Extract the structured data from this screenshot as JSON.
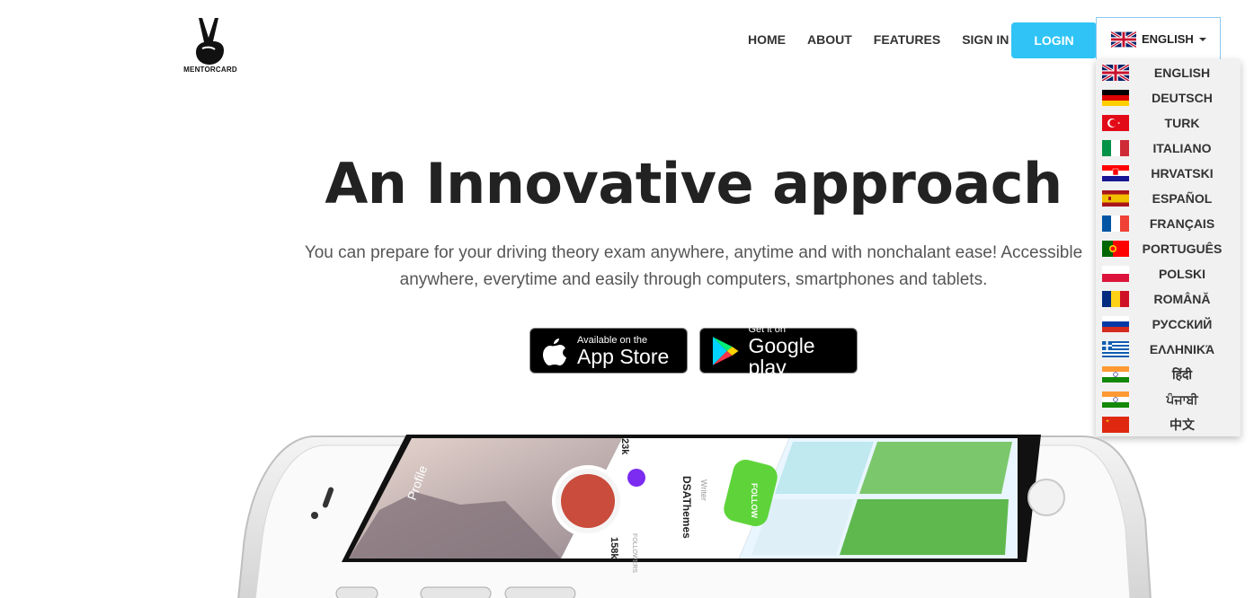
{
  "brand": {
    "name": "MENTORCARD"
  },
  "nav": {
    "items": [
      "HOME",
      "ABOUT",
      "FEATURES",
      "SIGN IN"
    ],
    "login_label": "LOGIN",
    "language_selected": "ENGLISH"
  },
  "languages": [
    {
      "label": "ENGLISH",
      "flag": "uk-flag-icon"
    },
    {
      "label": "DEUTSCH",
      "flag": "germany-flag-icon"
    },
    {
      "label": "TURK",
      "flag": "turkey-flag-icon"
    },
    {
      "label": "ITALIANO",
      "flag": "italy-flag-icon"
    },
    {
      "label": "HRVATSKI",
      "flag": "croatia-flag-icon"
    },
    {
      "label": "ESPAÑOL",
      "flag": "spain-flag-icon"
    },
    {
      "label": "FRANÇAIS",
      "flag": "france-flag-icon"
    },
    {
      "label": "PORTUGUÊS",
      "flag": "portugal-flag-icon"
    },
    {
      "label": "POLSKI",
      "flag": "poland-flag-icon"
    },
    {
      "label": "ROMÂNĂ",
      "flag": "romania-flag-icon"
    },
    {
      "label": "РУССКИЙ",
      "flag": "russia-flag-icon"
    },
    {
      "label": "ΕΛΛΗΝΙΚΆ",
      "flag": "greece-flag-icon"
    },
    {
      "label": "हिंदी",
      "flag": "india-flag-icon"
    },
    {
      "label": "ਪੰਜਾਬੀ",
      "flag": "india-flag-icon"
    },
    {
      "label": "中文",
      "flag": "china-flag-icon"
    }
  ],
  "hero": {
    "title": "An Innovative approach",
    "subtitle": "You can prepare for your driving theory exam anywhere, anytime and with nonchalant ease! Accessible anywhere, everytime and easily through computers, smartphones and tablets.",
    "appstore_small": "Available on the",
    "appstore_big": "App Store",
    "googleplay_small": "Get it on",
    "googleplay_big": "Google play"
  },
  "phone_screen": {
    "profile": "Profile",
    "name": "DSAThemes",
    "role": "Writer",
    "follow": "FOLLOW",
    "stat1": "23k",
    "stat2": "158k",
    "stat2_label": "FOLLOWERS"
  },
  "colors": {
    "accent": "#2fc4f5",
    "text": "#222222"
  }
}
